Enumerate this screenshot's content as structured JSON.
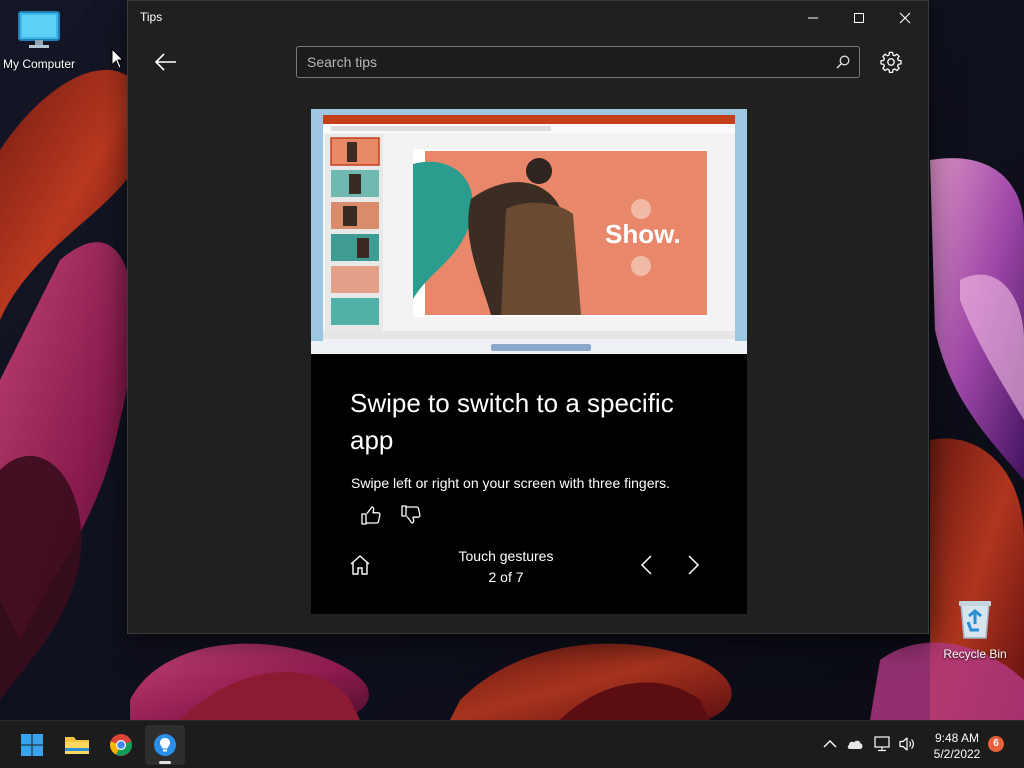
{
  "desktop": {
    "icons": [
      {
        "label": "My Computer",
        "icon": "monitor-icon"
      },
      {
        "label": "Recycle Bin",
        "icon": "recycle-bin-icon"
      }
    ]
  },
  "window": {
    "title": "Tips",
    "search": {
      "placeholder": "Search tips",
      "value": ""
    },
    "controls": [
      "minimize-icon",
      "maximize-icon",
      "close-icon"
    ],
    "back_icon": "arrow-left-icon",
    "settings_icon": "gear-icon"
  },
  "tip": {
    "heading": "Swipe to switch to a specific app",
    "body": "Swipe left or right on your screen with three fingers.",
    "preview_text": "Show.",
    "collection": "Touch gestures",
    "position": "2 of 7",
    "current": 2,
    "total": 7
  },
  "taskbar": {
    "apps": [
      {
        "name": "Start",
        "icon": "windows-logo-icon",
        "active": false
      },
      {
        "name": "File Explorer",
        "icon": "folder-icon",
        "active": false
      },
      {
        "name": "Google Chrome",
        "icon": "chrome-icon",
        "active": false
      },
      {
        "name": "Tips",
        "icon": "lightbulb-icon",
        "active": true
      }
    ],
    "tray": [
      "chevron-up-icon",
      "cloud-icon",
      "network-icon",
      "volume-icon"
    ],
    "time": "9:48 AM",
    "date": "5/2/2022",
    "notification_count": "6"
  },
  "colors": {
    "window_bg": "#202020",
    "card_bg": "#000000",
    "preview_orange": "#e88a66",
    "preview_teal": "#2a9d8f",
    "powerpoint_red": "#c43e1c",
    "badge": "#e8603c"
  }
}
